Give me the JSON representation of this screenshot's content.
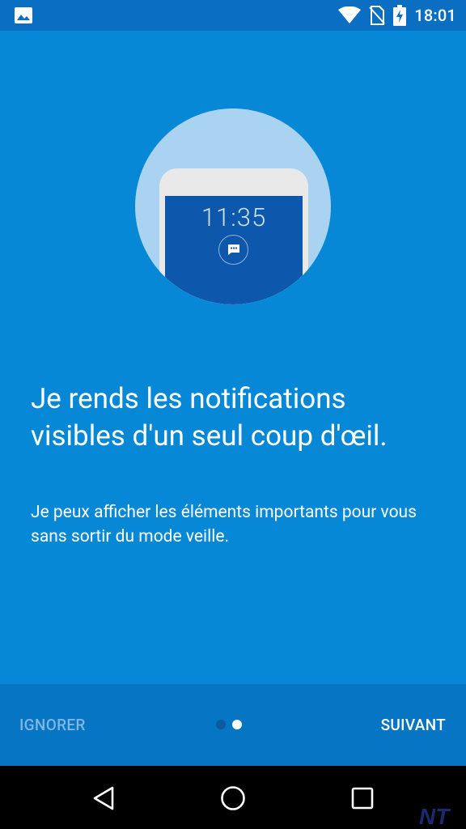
{
  "status_bar": {
    "time": "18:01",
    "icons": [
      "gallery-icon",
      "wifi-icon",
      "no-sim-icon",
      "battery-charging-icon"
    ]
  },
  "onboarding": {
    "illustration": {
      "clock_time": "11:35",
      "icon": "message-icon"
    },
    "headline": "Je rends les notifications visibles d'un seul coup d'œil.",
    "description": "Je peux afficher les éléments importants pour vous sans sortir du mode veille.",
    "page_indicator": {
      "current": 2,
      "total": 2
    }
  },
  "bottom_bar": {
    "skip_label": "IGNORER",
    "next_label": "SUIVANT"
  },
  "nav_bar": {
    "buttons": [
      "back-icon",
      "home-icon",
      "recents-icon"
    ]
  },
  "watermark": "NT",
  "colors": {
    "background": "#0688d6",
    "status_bar": "#0a6fc2",
    "bottom_bar": "#0676c4",
    "illustration_circle": "#a9d3f0",
    "phone_screen": "#0d57ad"
  }
}
